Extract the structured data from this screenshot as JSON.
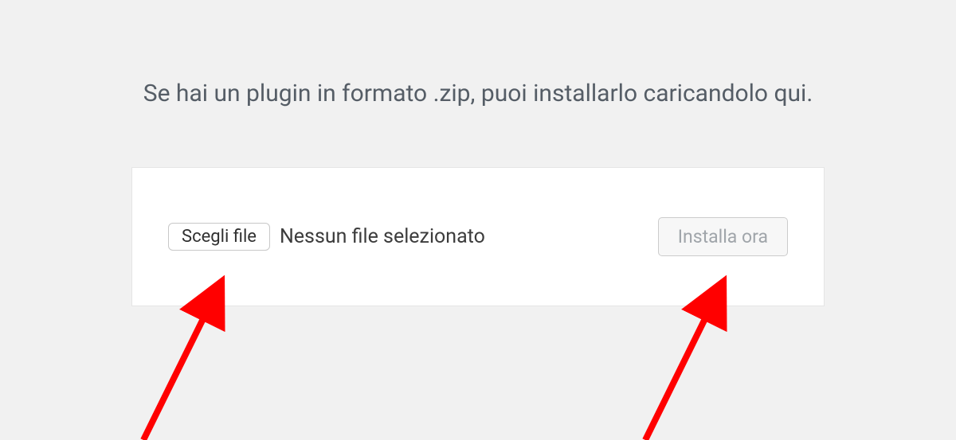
{
  "upload_section": {
    "description": "Se hai un plugin in formato .zip, puoi installarlo caricandolo qui.",
    "choose_file_label": "Scegli file",
    "no_file_selected_text": "Nessun file selezionato",
    "install_button_label": "Installa ora"
  }
}
